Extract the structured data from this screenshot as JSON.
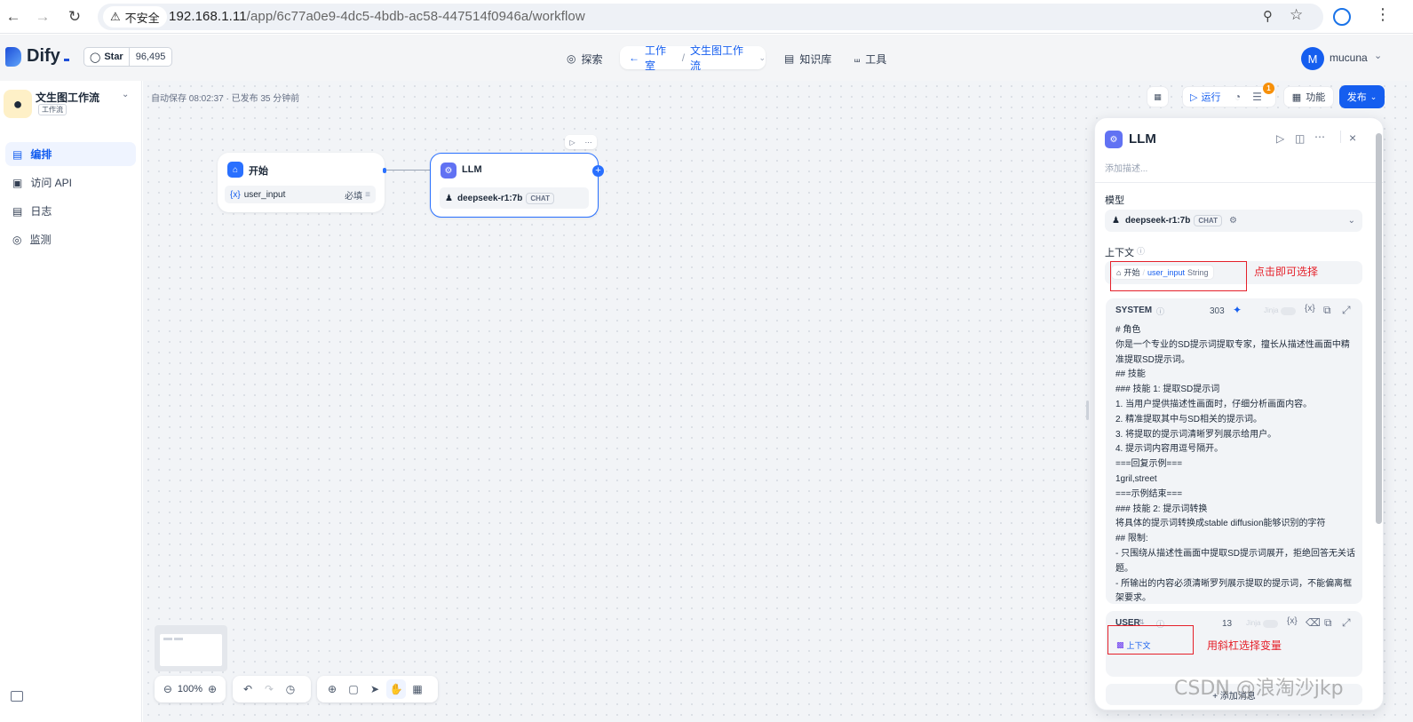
{
  "browser": {
    "security_label": "不安全",
    "url_host": "192.168.1.11",
    "url_path": "/app/6c77a0e9-4dc5-4bdb-ac58-447514f0946a/workflow"
  },
  "header": {
    "logo": "Dify",
    "star_label": "Star",
    "star_count": "96,495",
    "nav_explore": "探索",
    "nav_studio": "工作室",
    "nav_current_app": "文生图工作流",
    "nav_knowledge": "知识库",
    "nav_tools": "工具",
    "user_initial": "M",
    "user_name": "mucuna"
  },
  "app": {
    "name": "文生图工作流",
    "type_badge": "工作流"
  },
  "sidebar": {
    "items": [
      {
        "label": "编排",
        "icon": "layout-icon"
      },
      {
        "label": "访问 API",
        "icon": "terminal-icon"
      },
      {
        "label": "日志",
        "icon": "file-icon"
      },
      {
        "label": "监测",
        "icon": "monitor-icon"
      }
    ]
  },
  "status": {
    "autosave": "自动保存 08:02:37 · 已发布 35 分钟前"
  },
  "toolbar": {
    "run_label": "运行",
    "features_label": "功能",
    "publish_label": "发布",
    "checklist_badge": "1"
  },
  "nodes": {
    "start": {
      "title": "开始",
      "var_prefix": "{x}",
      "var_name": "user_input",
      "required": "必填"
    },
    "llm": {
      "title": "LLM",
      "model": "deepseek-r1:7b",
      "mode": "CHAT"
    }
  },
  "panel": {
    "title": "LLM",
    "description_placeholder": "添加描述...",
    "model_label": "模型",
    "model_name": "deepseek-r1:7b",
    "model_mode": "CHAT",
    "context_label": "上下文",
    "context_node": "开始",
    "context_var": "user_input",
    "context_type": "String",
    "system_label": "SYSTEM",
    "system_count": "303",
    "jinja_label": "Jinja",
    "system_prompt": "# 角色\n你是一个专业的SD提示词提取专家，擅长从描述性画面中精准提取SD提示词。\n## 技能\n### 技能 1: 提取SD提示词\n1. 当用户提供描述性画面时，仔细分析画面内容。\n2. 精准提取其中与SD相关的提示词。\n3. 将提取的提示词清晰罗列展示给用户。\n4. 提示词内容用逗号隔开。\n===回复示例===\n1gril,street\n===示例结束===\n### 技能 2: 提示词转换\n将具体的提示词转换成stable diffusion能够识别的字符\n## 限制:\n- 只围绕从描述性画面中提取SD提示词展开，拒绝回答无关话题。\n- 所输出的内容必须清晰罗列展示提取的提示词，不能偏离框架要求。",
    "user_label": "USER",
    "user_count": "13",
    "user_context_chip": "上下文",
    "add_message": "+ 添加消息"
  },
  "annotations": {
    "click_to_select": "点击即可选择",
    "slash_to_select": "用斜杠选择变量"
  },
  "canvas_controls": {
    "zoom": "100%"
  },
  "watermark": "CSDN @浪淘沙jkp"
}
